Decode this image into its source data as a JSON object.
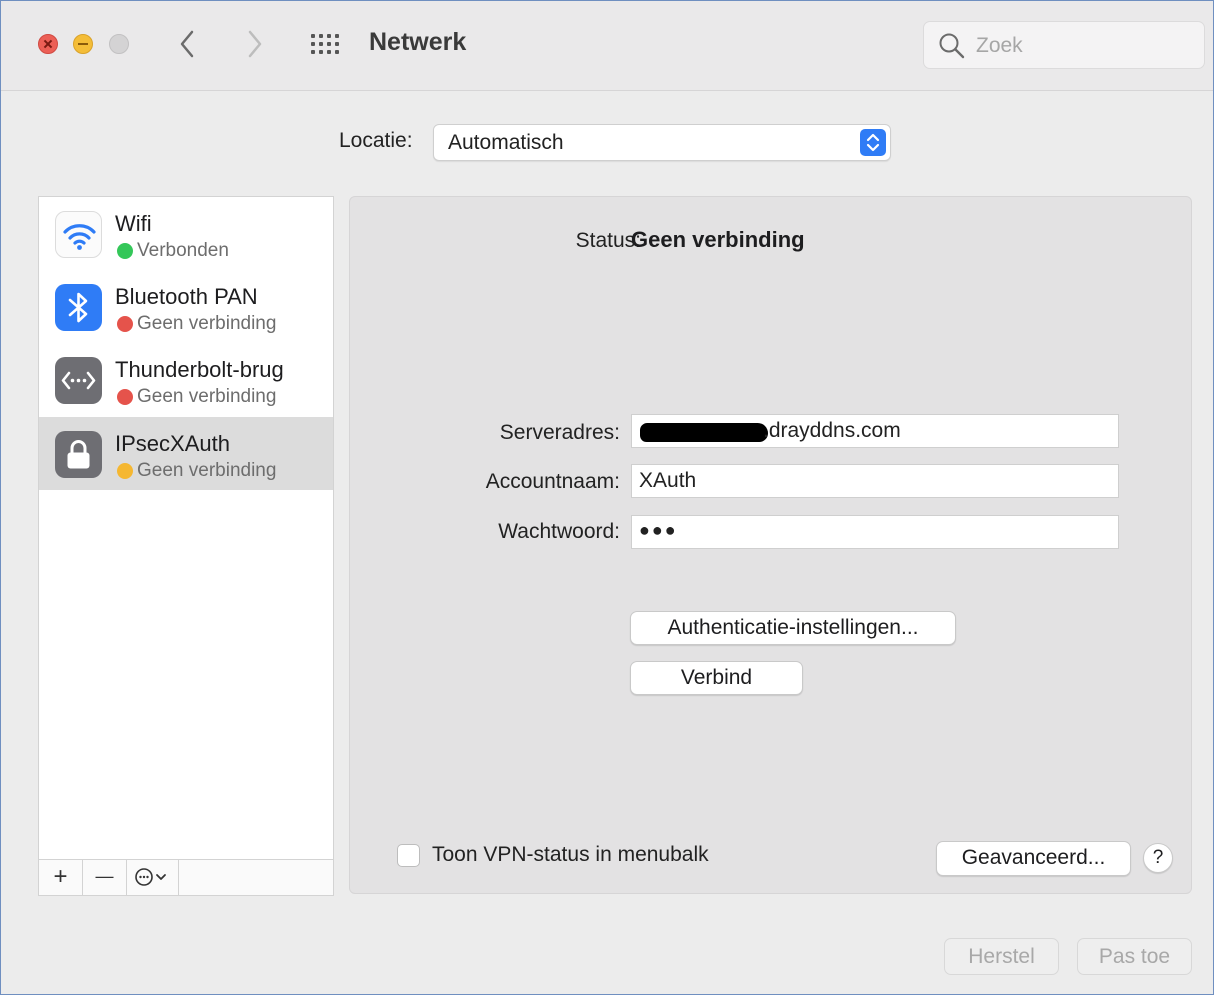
{
  "window": {
    "title": "Netwerk",
    "search_placeholder": "Zoek"
  },
  "location": {
    "label": "Locatie:",
    "value": "Automatisch"
  },
  "services": [
    {
      "name": "Wifi",
      "status": "Verbonden",
      "status_color": "#34c759",
      "icon": "wifi-icon"
    },
    {
      "name": "Bluetooth PAN",
      "status": "Geen verbinding",
      "status_color": "#e5534b",
      "icon": "bluetooth-icon"
    },
    {
      "name": "Thunderbolt-brug",
      "status": "Geen verbinding",
      "status_color": "#e5534b",
      "icon": "thunderbolt-bridge-icon"
    },
    {
      "name": "IPsecXAuth",
      "status": "Geen verbinding",
      "status_color": "#f5b731",
      "icon": "lock-icon",
      "selected": true
    }
  ],
  "sidebar_toolbar": {
    "add": "+",
    "remove": "—"
  },
  "detail": {
    "status_label": "Status:",
    "status_value": "Geen verbinding",
    "server_label": "Serveradres:",
    "server_value": ".drayddns.com",
    "account_label": "Accountnaam:",
    "account_value": "XAuth",
    "password_label": "Wachtwoord:",
    "password_value": "●●●",
    "auth_button": "Authenticatie-instellingen...",
    "connect_button": "Verbind",
    "show_vpn_status": "Toon VPN-status in menubalk",
    "show_vpn_checked": false,
    "advanced_button": "Geavanceerd...",
    "help_button": "?"
  },
  "footer": {
    "revert_button": "Herstel",
    "apply_button": "Pas toe"
  },
  "colors": {
    "accent": "#2f7cf6",
    "window_border": "#6f8fc0"
  }
}
